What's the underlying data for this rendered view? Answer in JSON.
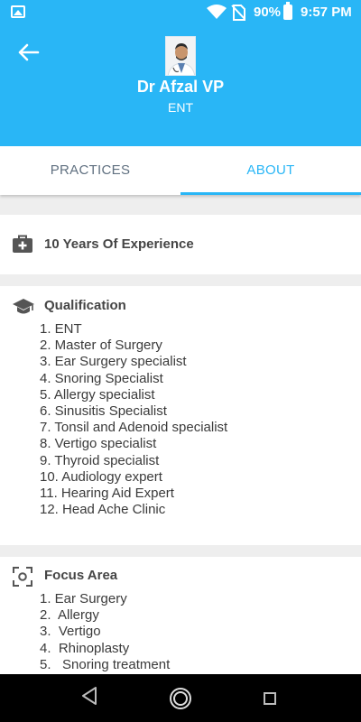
{
  "status_bar": {
    "battery_percent": "90%",
    "time": "9:57 PM"
  },
  "header": {
    "doctor_name": "Dr Afzal VP",
    "specialty": "ENT"
  },
  "tabs": [
    {
      "label": "PRACTICES",
      "selected": false
    },
    {
      "label": "ABOUT",
      "selected": true
    }
  ],
  "experience": {
    "text": "10 Years Of Experience"
  },
  "qualification": {
    "title": "Qualification",
    "items": [
      "1. ENT",
      "2. Master of Surgery",
      "3. Ear Surgery specialist",
      "4. Snoring Specialist",
      "5. Allergy specialist",
      "6. Sinusitis Specialist",
      "7. Tonsil and Adenoid specialist",
      "8. Vertigo specialist",
      "9. Thyroid specialist",
      "10. Audiology expert",
      "11. Hearing Aid Expert",
      "12. Head Ache Clinic"
    ]
  },
  "focus_area": {
    "title": "Focus Area",
    "items": [
      "1. Ear Surgery",
      "2.  Allergy",
      "3.  Vertigo",
      "4.  Rhinoplasty",
      "5.   Snoring treatment"
    ]
  },
  "colors": {
    "accent": "#29b6f6",
    "background": "#eeeeee",
    "text_dark": "#454545",
    "tab_inactive": "#607080"
  }
}
